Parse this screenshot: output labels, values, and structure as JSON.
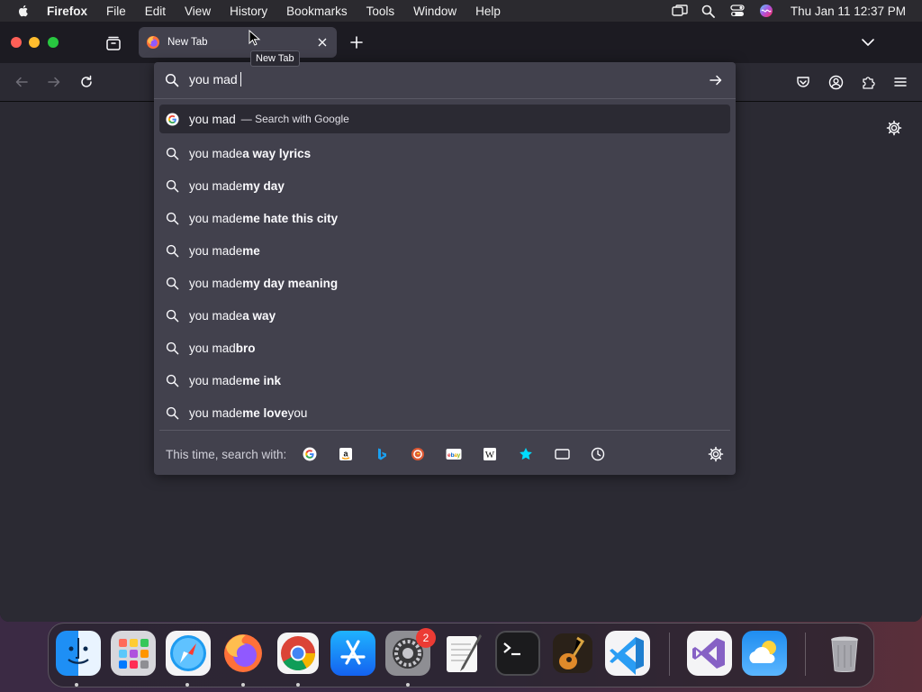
{
  "menubar": {
    "apple_icon": "apple-logo",
    "items": [
      "Firefox",
      "File",
      "Edit",
      "View",
      "History",
      "Bookmarks",
      "Tools",
      "Window",
      "Help"
    ],
    "clock": "Thu Jan 11  12:37 PM",
    "status_icons": [
      "screen-mirroring-icon",
      "spotlight-search-icon",
      "control-center-icon",
      "siri-icon"
    ]
  },
  "browser": {
    "tab": {
      "title": "New Tab",
      "tooltip": "New Tab"
    },
    "toolbar_icons": [
      "back-icon",
      "forward-icon",
      "reload-icon",
      "pocket-icon",
      "account-icon",
      "extensions-icon",
      "menu-icon"
    ]
  },
  "urlbar": {
    "value": "you mad",
    "first_result": {
      "typed": "you mad",
      "action": "— Search with Google"
    },
    "suggestions": [
      {
        "prefix": "you made",
        "suffix": " a way lyrics",
        "tail": ""
      },
      {
        "prefix": "you made",
        "suffix": " my day",
        "tail": ""
      },
      {
        "prefix": "you made",
        "suffix": " me hate this city",
        "tail": ""
      },
      {
        "prefix": "you made",
        "suffix": " me",
        "tail": ""
      },
      {
        "prefix": "you made",
        "suffix": " my day meaning",
        "tail": ""
      },
      {
        "prefix": "you made",
        "suffix": " a way",
        "tail": ""
      },
      {
        "prefix": "you mad",
        "suffix": " bro",
        "tail": ""
      },
      {
        "prefix": "you made",
        "suffix": " me ink",
        "tail": ""
      },
      {
        "prefix": "you made",
        "suffix": " me love",
        "tail": " you"
      }
    ],
    "oneoff_label": "This time, search with:",
    "engines": [
      "google-icon",
      "amazon-icon",
      "bing-icon",
      "duckduckgo-icon",
      "ebay-icon",
      "wikipedia-icon",
      "bookmarks-icon",
      "tabs-icon",
      "history-icon"
    ]
  },
  "dock": {
    "apps": [
      "Finder",
      "Launchpad",
      "Safari",
      "Firefox",
      "Google Chrome",
      "App Store",
      "System Settings",
      "TextEdit",
      "Terminal",
      "GarageBand",
      "Visual Studio Code",
      "Visual Studio",
      "Weather",
      "Trash"
    ],
    "settings_badge": "2"
  }
}
